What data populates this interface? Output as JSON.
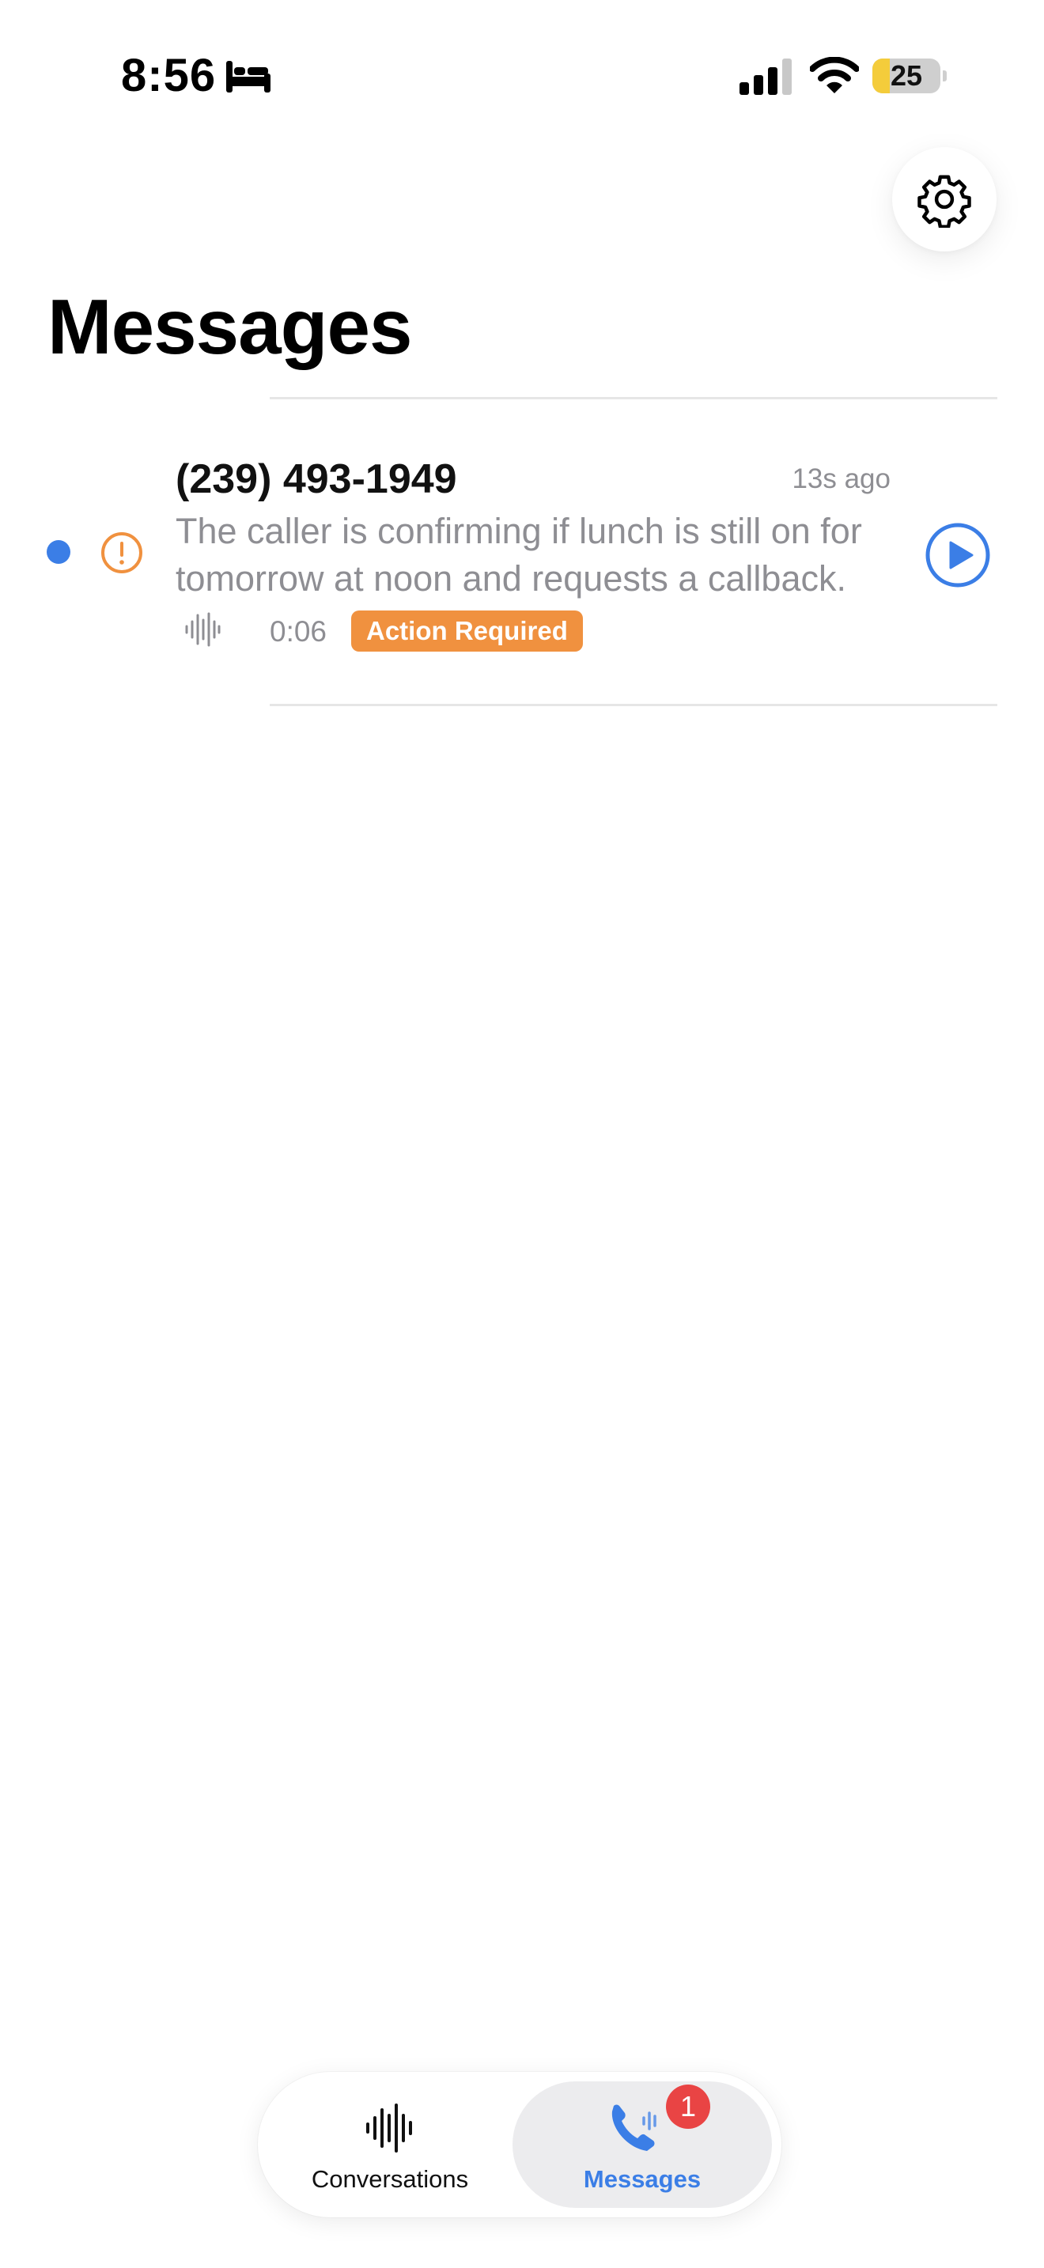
{
  "status_bar": {
    "time": "8:56",
    "focus_icon": "bed-icon",
    "signal_icon": "cellular-signal-icon",
    "wifi_icon": "wifi-icon",
    "battery_level": "25",
    "battery_fraction": 0.25,
    "battery_color": "#f4cc3b"
  },
  "header": {
    "settings_icon": "gear-icon",
    "title": "Messages"
  },
  "messages": [
    {
      "caller": "(239) 493-1949",
      "time_ago": "13s ago",
      "summary": "The caller is confirming if lunch is still on for tomorrow at noon and requests a callback.",
      "duration": "0:06",
      "status": "Action Required",
      "status_color": "#f0913f",
      "unread": true,
      "unread_color": "#3b7ee6",
      "alert_icon": "exclamation-circle-icon",
      "waveform_icon": "waveform-icon",
      "play_icon": "play-circle-icon"
    }
  ],
  "tab_bar": {
    "tabs": [
      {
        "label": "Conversations",
        "icon": "waveform-icon",
        "selected": false
      },
      {
        "label": "Messages",
        "icon": "phone-voicemail-icon",
        "selected": true,
        "badge": "1"
      }
    ],
    "accent_color": "#3b7ee6",
    "badge_color": "#e94444"
  }
}
